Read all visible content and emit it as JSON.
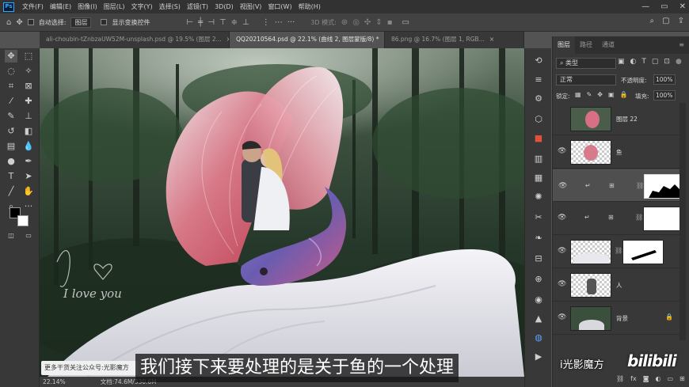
{
  "menu": {
    "app_icon": "Ps",
    "items": [
      "文件(F)",
      "编辑(E)",
      "图像(I)",
      "图层(L)",
      "文字(Y)",
      "选择(S)",
      "滤镜(T)",
      "3D(D)",
      "视图(V)",
      "窗口(W)",
      "帮助(H)"
    ]
  },
  "options": {
    "auto_select_label": "自动选择:",
    "auto_select_value": "图层",
    "transform_label": "显示变换控件",
    "mode_3d": "3D 模式:"
  },
  "tabs": [
    {
      "label": "ali-choubin-tZnbzaUW52M-unsplash.psd @ 19.5% (图层 2...",
      "close": "×"
    },
    {
      "label": "QQ20210564.psd @ 22.1% (曲线 2, 图层蒙版/8) *",
      "close": "×"
    },
    {
      "label": "86.png @ 16.7% (图层 1, RGB...",
      "close": "×"
    }
  ],
  "status": {
    "zoom": "22.14%",
    "doc": "文档:74.6M/330.6M"
  },
  "layers_panel": {
    "tabs": [
      "图层",
      "路径",
      "通道"
    ],
    "filter_label": "类型",
    "blend_mode": "正常",
    "opacity_label": "不透明度:",
    "opacity_value": "100%",
    "lock_label": "锁定:",
    "fill_label": "填充:",
    "fill_value": "100%",
    "layers": [
      {
        "name": "图层 22"
      },
      {
        "name": "鱼"
      },
      {
        "name": ""
      },
      {
        "name": ""
      },
      {
        "name": ""
      },
      {
        "name": "人"
      },
      {
        "name": "背景"
      }
    ]
  },
  "watermark": {
    "love_text": "I love you"
  },
  "overlay": {
    "subtitle": "我们接下来要处理的是关于鱼的一个处理",
    "follow": "更多干货关注公众号:光影魔方",
    "brand": "i光影魔方",
    "bilibili": "bilibili"
  }
}
